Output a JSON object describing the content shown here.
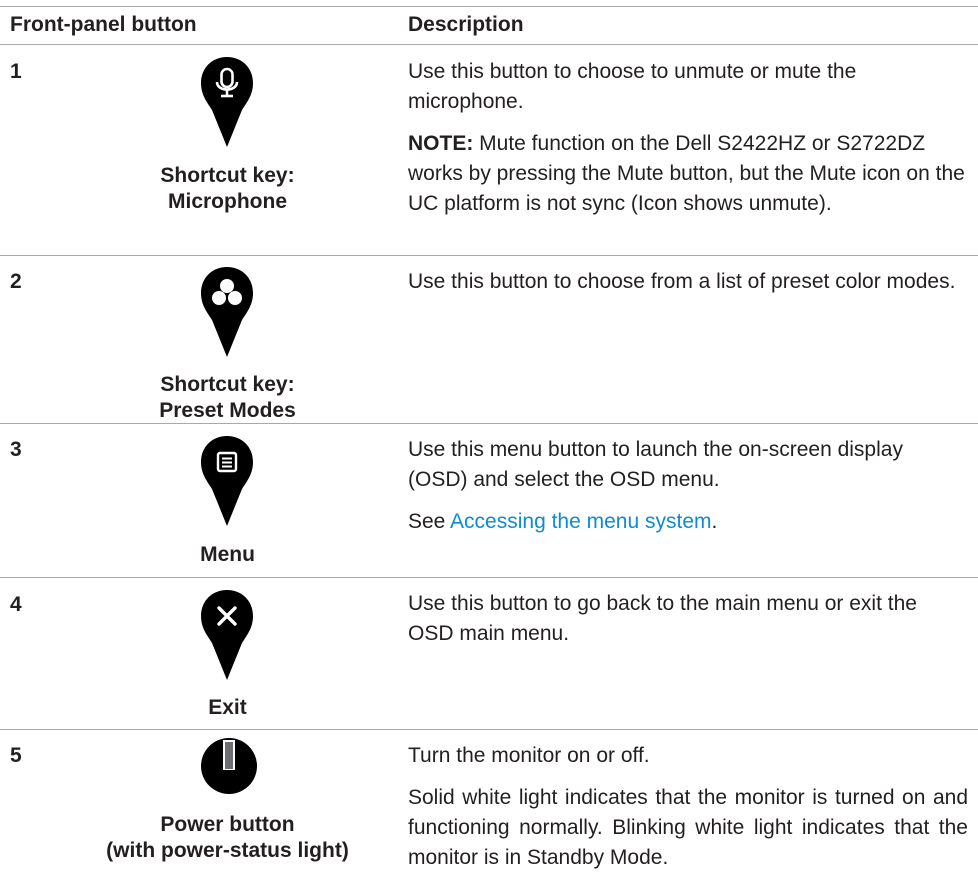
{
  "header": {
    "col1": "Front-panel button",
    "col2": "Description"
  },
  "rows": [
    {
      "number": "1",
      "icon": "microphone-icon",
      "label_line1": "Shortcut key:",
      "label_line2": "Microphone",
      "desc1": "Use this button to choose to unmute or mute the microphone.",
      "note_label": "NOTE:",
      "note_text": " Mute function on the Dell S2422HZ or S2722DZ works by pressing the Mute button, but the Mute icon on the UC platform is not sync (Icon shows unmute)."
    },
    {
      "number": "2",
      "icon": "preset-modes-icon",
      "label_line1": "Shortcut key:",
      "label_line2": "Preset Modes",
      "desc1": "Use this button to choose from a list of preset color modes."
    },
    {
      "number": "3",
      "icon": "menu-icon",
      "label_line1": "Menu",
      "desc1": "Use this menu button to launch the on-screen display (OSD) and select the OSD menu.",
      "see_prefix": "See ",
      "link_text": "Accessing the menu system",
      "see_suffix": "."
    },
    {
      "number": "4",
      "icon": "exit-icon",
      "label_line1": "Exit",
      "desc1": "Use this button to go back to the main menu or exit the OSD main menu."
    },
    {
      "number": "5",
      "icon": "power-icon",
      "label_line1": "Power button",
      "label_line2": "(with power-status light)",
      "desc1": "Turn the monitor on or off.",
      "desc2": "Solid white light indicates that the monitor is turned on and functioning normally. Blinking white light indicates that the monitor is in Standby Mode."
    }
  ],
  "colors": {
    "text": "#231f20",
    "icon": "#000000",
    "rule": "#a7a9ac",
    "link": "#0e8ccf"
  }
}
